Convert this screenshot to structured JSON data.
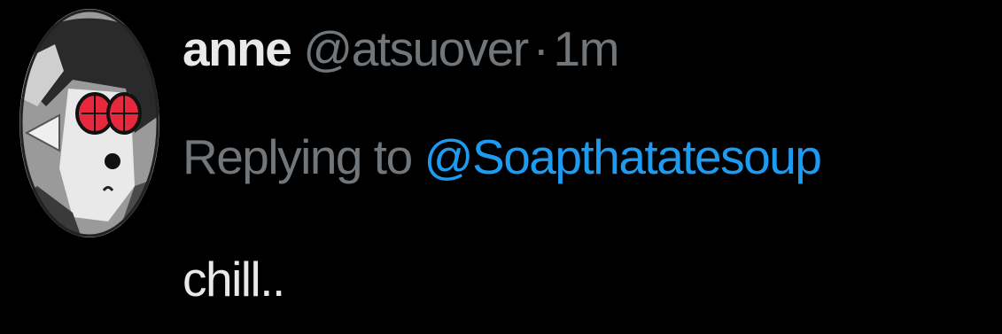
{
  "tweet": {
    "author": {
      "display_name": "anne",
      "handle": "@atsuover",
      "separator": "·",
      "timestamp": "1m",
      "avatar_icon": "avatar-image"
    },
    "reply": {
      "prefix": "Replying to",
      "to_handle": "@Soapthatatesoup"
    },
    "text": "chill.."
  },
  "colors": {
    "background": "#000000",
    "primary_text": "#e7e9ea",
    "secondary_text": "#71767b",
    "link": "#1d9bf0"
  }
}
